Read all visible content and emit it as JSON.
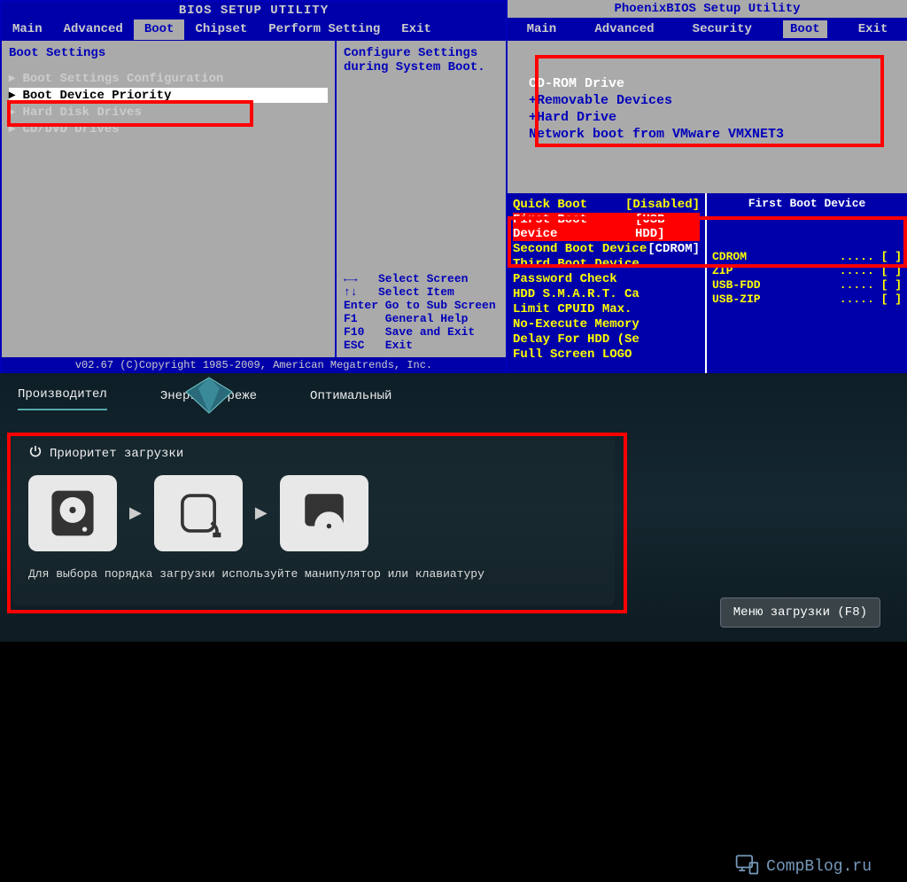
{
  "ami": {
    "title": "BIOS SETUP UTILITY",
    "tabs": [
      "Main",
      "Advanced",
      "Boot",
      "Chipset",
      "Perform Setting",
      "Exit"
    ],
    "active_tab": 2,
    "heading": "Boot Settings",
    "items": [
      "Boot Settings Configuration",
      "Boot Device Priority",
      "Hard Disk Drives",
      "CD/DVD Drives"
    ],
    "selected": 1,
    "help": "Configure Settings\nduring System Boot.",
    "keys": "←→   Select Screen\n↑↓   Select Item\nEnter Go to Sub Screen\nF1    General Help\nF10   Save and Exit\nESC   Exit",
    "footer": "v02.67 (C)Copyright 1985-2009, American Megatrends, Inc."
  },
  "phoenix": {
    "title": "PhoenixBIOS Setup Utility",
    "tabs": [
      "Main",
      "Advanced",
      "Security",
      "Boot",
      "Exit"
    ],
    "active_tab": 3,
    "items": [
      " CD-ROM Drive",
      "+Removable Devices",
      "+Hard Drive",
      " Network boot from VMware VMXNET3"
    ],
    "selected": 0
  },
  "award": {
    "left_top": [
      {
        "k": "Quick Boot",
        "v": "[Disabled]"
      }
    ],
    "boot_devs": [
      {
        "k": "First Boot Device",
        "v": "[USB-HDD]"
      },
      {
        "k": "Second Boot Device",
        "v": "[CDROM]"
      },
      {
        "k": "Third Boot Device",
        "v": ""
      }
    ],
    "left_bottom": [
      "Password Check",
      "HDD S.M.A.R.T. Ca",
      "Limit CPUID Max.",
      "No-Execute Memory",
      "Delay For HDD (Se",
      "Full Screen LOGO"
    ],
    "right_title": "First Boot Device",
    "options": [
      {
        "name": "CDROM",
        "dots": "..... [ ]"
      },
      {
        "name": "ZIP",
        "dots": "..... [ ]"
      },
      {
        "name": "USB-FDD",
        "dots": "..... [ ]"
      },
      {
        "name": "USB-ZIP",
        "dots": "..... [ ]"
      }
    ]
  },
  "uefi": {
    "tabs": [
      "Производител",
      "Энергосбереже",
      "Оптимальный"
    ],
    "active_tab": 0,
    "panel_title": "Приоритет загрузки",
    "hint": "Для выбора порядка загрузки используйте манипулятор или клавиатуру",
    "brand": "CompBlog.ru",
    "menu_btn": "Меню загрузки (F8)",
    "boot_order": [
      "hdd-icon",
      "usb-icon",
      "cd-icon"
    ]
  }
}
